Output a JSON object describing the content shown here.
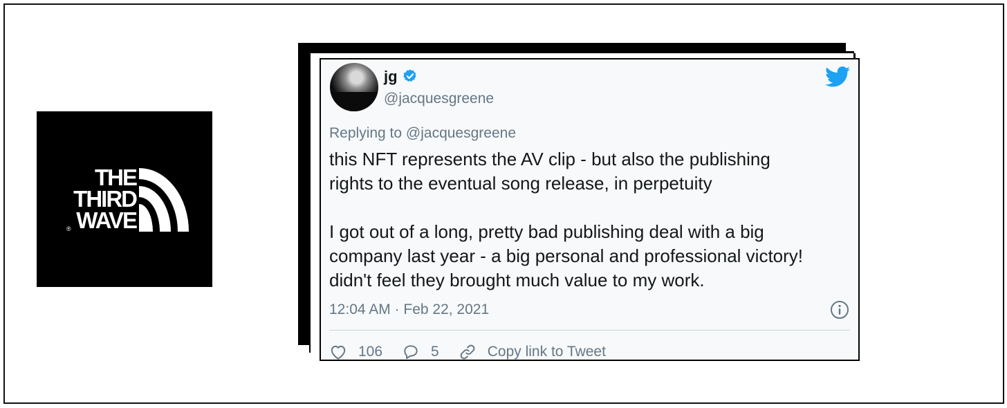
{
  "logo": {
    "line1": "THE",
    "line2": "THIRD",
    "line3": "WAVE",
    "registered": "®"
  },
  "tweet": {
    "display_name": "jg",
    "handle": "@jacquesgreene",
    "replying_label": "Replying to",
    "replying_to": "@jacquesgreene",
    "paragraph1_line1": "this NFT represents the AV clip - but also the publishing",
    "paragraph1_line2": "rights to the eventual song release, in perpetuity",
    "paragraph2_line1": "I got out of a long, pretty bad publishing deal with a big",
    "paragraph2_line2": "company last year - a big personal and professional victory!",
    "paragraph2_line3": "didn't feel they brought much value to my work.",
    "timestamp": "12:04 AM · Feb 22, 2021",
    "likes": "106",
    "replies": "5",
    "copy_link_label": "Copy link to Tweet"
  },
  "icons": {
    "verified": "verified-badge-icon",
    "brand": "twitter-bird-icon",
    "info": "info-icon",
    "like": "heart-icon",
    "reply": "speech-bubble-icon",
    "copy": "link-icon"
  },
  "colors": {
    "twitter_blue": "#1da1f2",
    "secondary_text": "#657786",
    "primary_text": "#14171a",
    "card_bg": "#f7f9fa"
  }
}
